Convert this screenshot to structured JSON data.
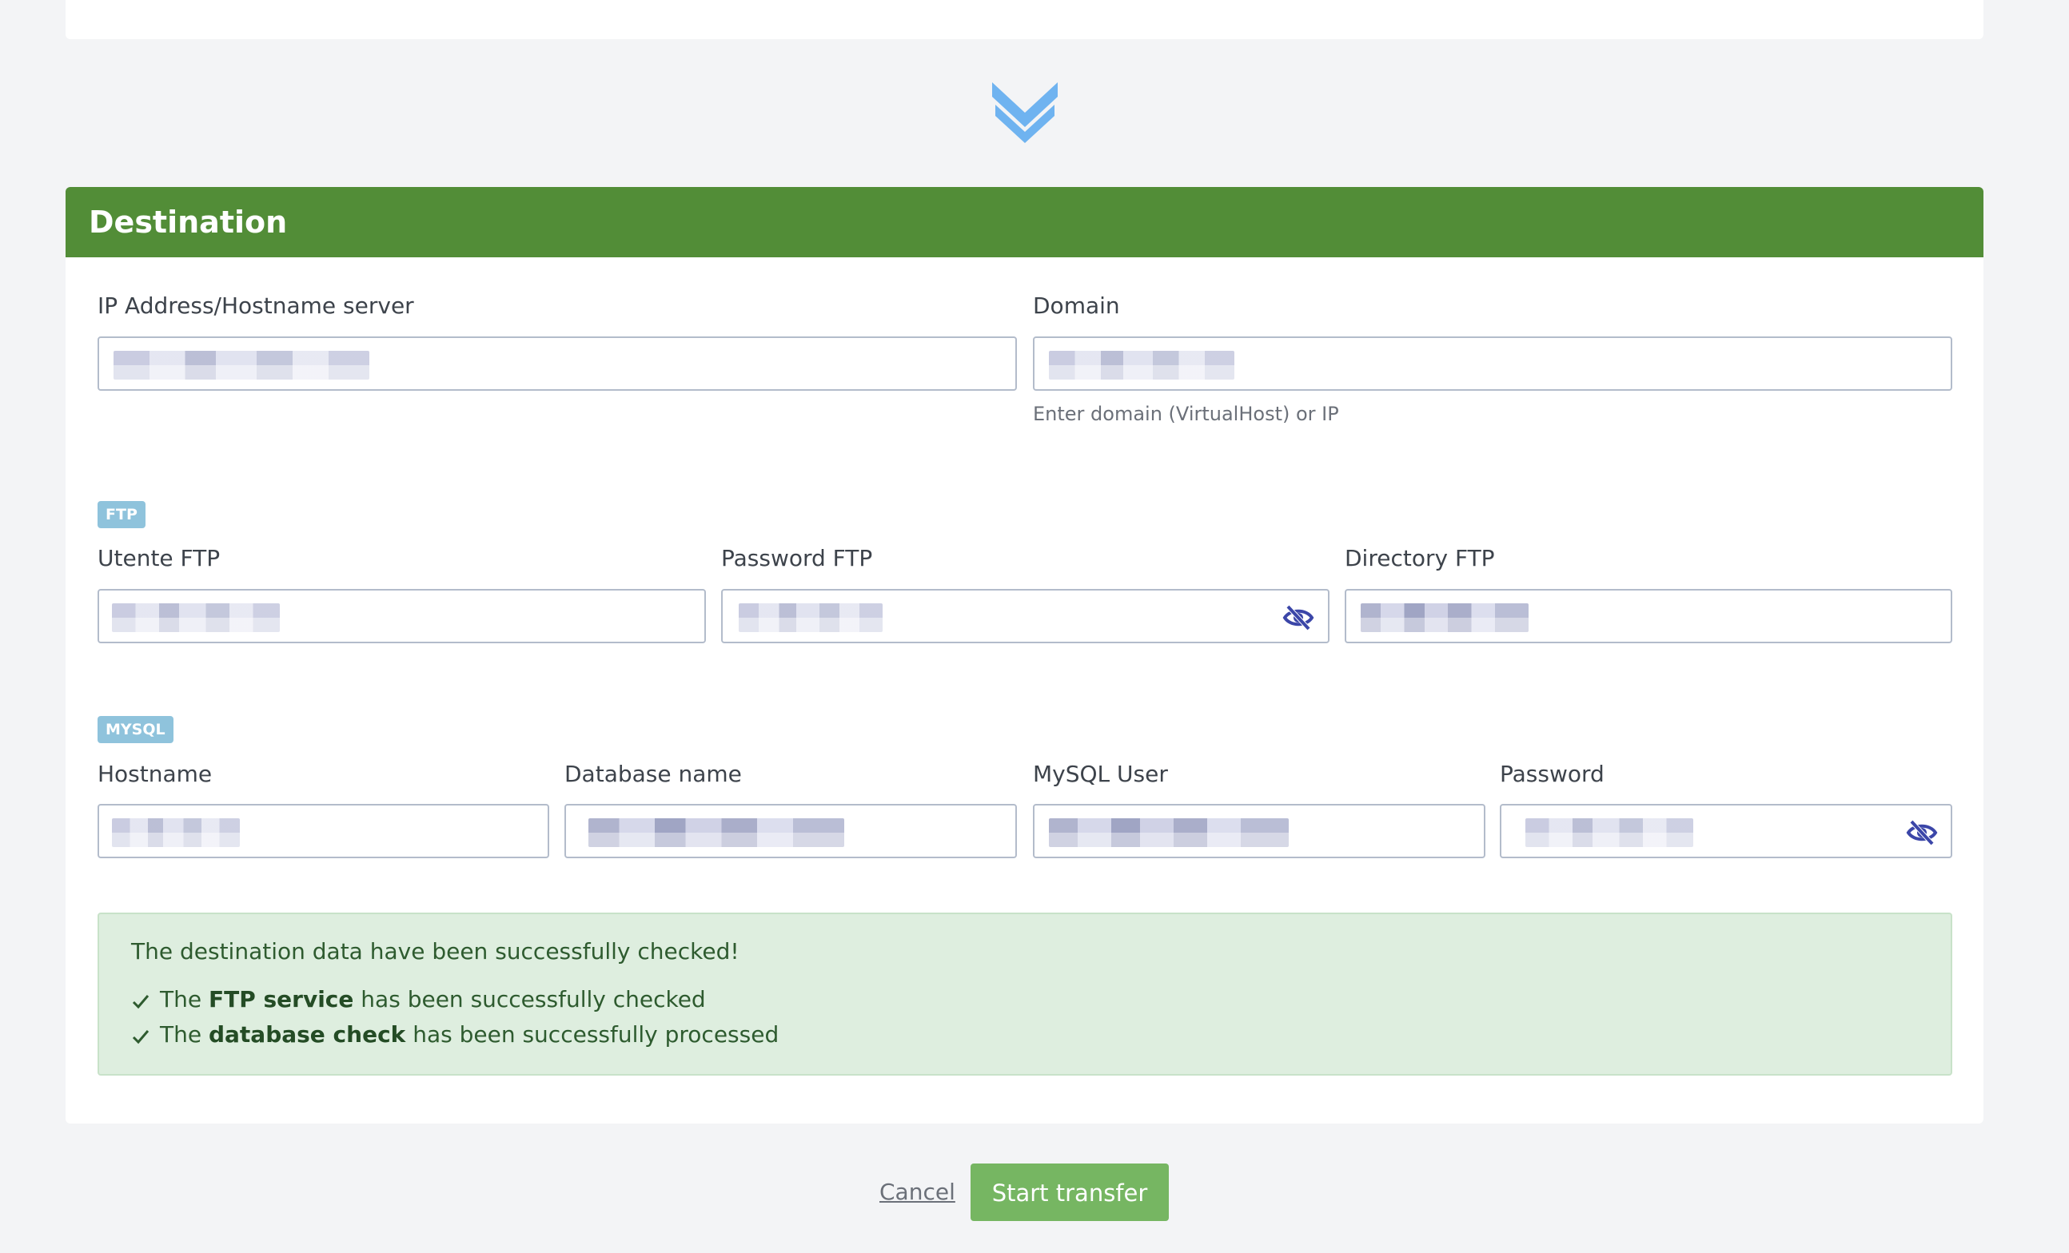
{
  "destination": {
    "title": "Destination",
    "ip": {
      "label": "IP Address/Hostname server"
    },
    "domain": {
      "label": "Domain",
      "hint": "Enter domain (VirtualHost) or IP"
    },
    "ftp": {
      "tag": "FTP",
      "user_label": "Utente FTP",
      "password_label": "Password FTP",
      "directory_label": "Directory FTP"
    },
    "mysql": {
      "tag": "MYSQL",
      "hostname_label": "Hostname",
      "dbname_label": "Database name",
      "user_label": "MySQL User",
      "password_label": "Password"
    },
    "alert": {
      "title": "The destination data have been successfully checked!",
      "items": [
        {
          "prefix": "The",
          "bold": "FTP service",
          "suffix": "has been successfully checked"
        },
        {
          "prefix": "The",
          "bold": "database check",
          "suffix": "has been successfully processed"
        }
      ]
    }
  },
  "actions": {
    "cancel_label": "Cancel",
    "start_label": "Start transfer"
  },
  "icons": {
    "divider": "double-chevron-down-icon",
    "password_toggle": "eye-slash-icon",
    "check": "check-icon"
  },
  "colors": {
    "header": "#528d37",
    "chevron": "#6fb3f0",
    "start_button": "#76b662",
    "tag": "#8fc3dc",
    "alert_bg": "#deeedf",
    "eye_icon": "#3b46a8"
  }
}
